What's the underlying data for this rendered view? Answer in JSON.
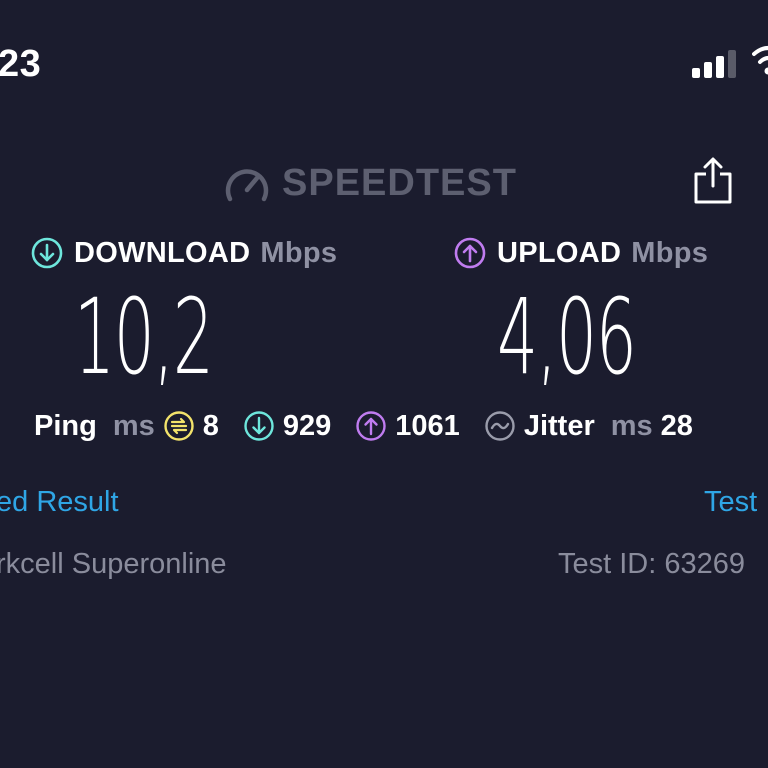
{
  "status_bar": {
    "time": "23",
    "signal_icon": "cellular-signal-icon",
    "wifi_icon": "wifi-icon"
  },
  "header": {
    "logo_text": "SPEEDTEST",
    "logo_icon": "speedometer-icon",
    "share_icon": "share-icon"
  },
  "download": {
    "label": "DOWNLOAD",
    "unit": "Mbps",
    "value": "10,2",
    "icon_color": "#6ee6dc"
  },
  "upload": {
    "label": "UPLOAD",
    "unit": "Mbps",
    "value": "4,06",
    "icon_color": "#c07cf0"
  },
  "metrics": {
    "ping_label": "Ping",
    "ping_unit": "ms",
    "ping_value": "8",
    "ping_icon_color": "#f3e36b",
    "download_latency": "929",
    "upload_latency": "1061",
    "jitter_label": "Jitter",
    "jitter_unit": "ms",
    "jitter_value": "28",
    "jitter_icon_color": "#9a9cab"
  },
  "links": {
    "left": "ed Result",
    "right": "Test"
  },
  "info": {
    "isp": "rkcell Superonline",
    "test_id": "Test ID: 63269"
  },
  "colors": {
    "background": "#1b1c2e",
    "link": "#2fa6e6",
    "muted": "#8f91a3"
  }
}
